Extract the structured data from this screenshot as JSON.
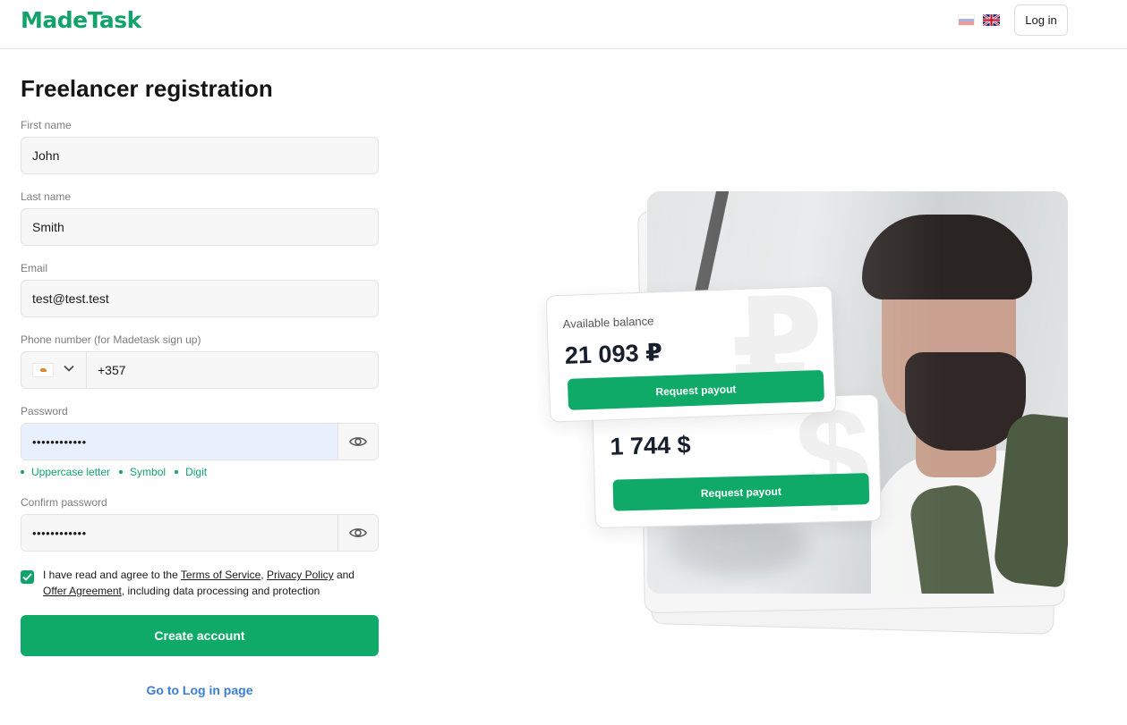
{
  "header": {
    "logo": "MadeTask",
    "login_label": "Log in"
  },
  "form": {
    "title": "Freelancer registration",
    "first_name": {
      "label": "First name",
      "value": "John"
    },
    "last_name": {
      "label": "Last name",
      "value": "Smith"
    },
    "email": {
      "label": "Email",
      "value": "test@test.test"
    },
    "phone": {
      "label": "Phone number (for Madetask sign up)",
      "value": "+357"
    },
    "password": {
      "label": "Password",
      "value": "••••••••••••"
    },
    "hints": [
      "Uppercase letter",
      "Symbol",
      "Digit"
    ],
    "confirm_password": {
      "label": "Confirm password",
      "value": "••••••••••••"
    },
    "agreement": {
      "prefix": "I have read and agree to the ",
      "terms": "Terms of Service",
      "sep1": ", ",
      "privacy": "Privacy Policy",
      "sep2": " and ",
      "offer": "Offer Agreement",
      "suffix": ", including data processing and protection",
      "checked": true
    },
    "create_label": "Create account",
    "goto_login_label": "Go to Log in page"
  },
  "illustration": {
    "card_rub": {
      "title": "Available balance",
      "amount": "21 093 ₽",
      "button": "Request payout",
      "ghost": "₽"
    },
    "card_usd": {
      "amount": "1 744 $",
      "button": "Request payout",
      "ghost": "$"
    }
  },
  "colors": {
    "brand": "#0fa968",
    "link": "#3b7fd4"
  }
}
